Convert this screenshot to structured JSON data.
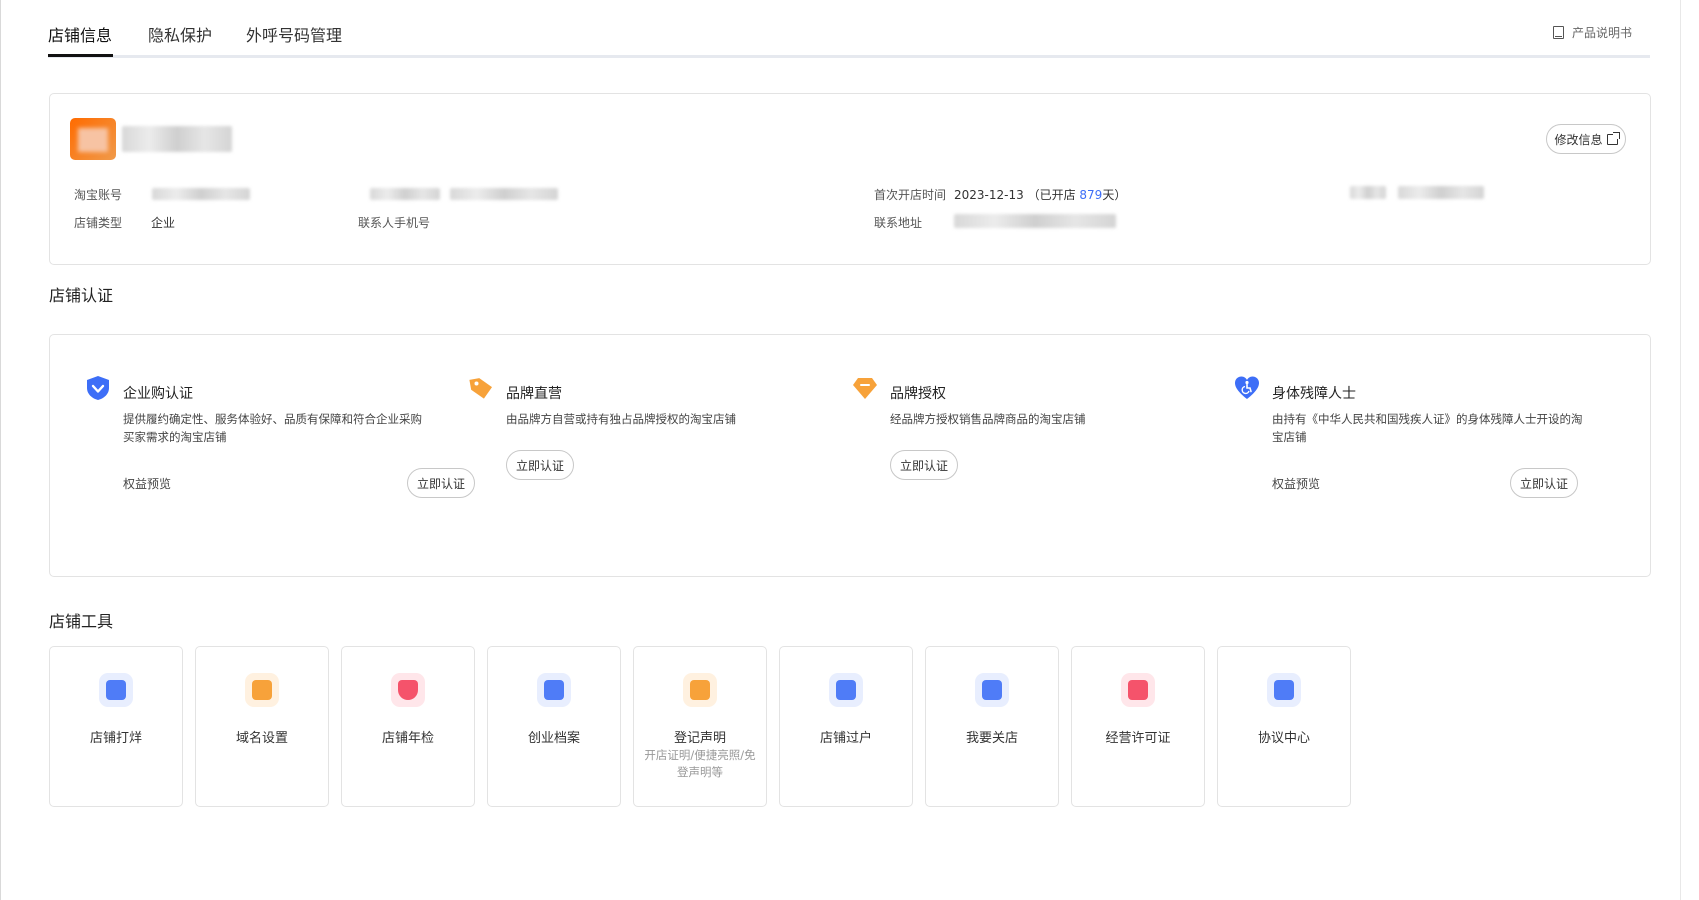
{
  "tabs": [
    {
      "label": "店铺信息",
      "active": true
    },
    {
      "label": "隐私保护",
      "active": false
    },
    {
      "label": "外呼号码管理",
      "active": false
    }
  ],
  "manual_label": "产品说明书",
  "store_info": {
    "edit_button": "修改信息",
    "fields": {
      "account_label": "淘宝账号",
      "type_label": "店铺类型",
      "type_value": "企业",
      "phone_label": "联系人手机号",
      "open_time_label": "首次开店时间",
      "open_time_value": "2023-12-13",
      "open_days_prefix": "（已开店 ",
      "open_days_value": "879",
      "open_days_suffix": "天）",
      "address_label": "联系地址"
    }
  },
  "certification": {
    "title": "店铺认证",
    "items": [
      {
        "title": "企业购认证",
        "desc": "提供履约确定性、服务体验好、品质有保障和符合企业采购买家需求的淘宝店铺",
        "link": "权益预览",
        "button": "立即认证",
        "icon": "shield-check-icon",
        "color": "#3d6ef7"
      },
      {
        "title": "品牌直营",
        "desc": "由品牌方自营或持有独占品牌授权的淘宝店铺",
        "link": "",
        "button": "立即认证",
        "icon": "tag-icon",
        "color": "#f7a23a"
      },
      {
        "title": "品牌授权",
        "desc": "经品牌方授权销售品牌商品的淘宝店铺",
        "link": "",
        "button": "立即认证",
        "icon": "diamond-icon",
        "color": "#f7a23a"
      },
      {
        "title": "身体残障人士",
        "desc": "由持有《中华人民共和国残疾人证》的身体残障人士开设的淘宝店铺",
        "link": "权益预览",
        "button": "立即认证",
        "icon": "heart-accessibility-icon",
        "color": "#3d6ef7"
      }
    ]
  },
  "tools": {
    "title": "店铺工具",
    "items": [
      {
        "label": "店铺打烊",
        "sub": "",
        "icon": "store-close-icon",
        "color": "#4f7cf7"
      },
      {
        "label": "域名设置",
        "sub": "",
        "icon": "domain-icon",
        "color": "#f7a23a"
      },
      {
        "label": "店铺年检",
        "sub": "",
        "icon": "annual-check-icon",
        "color": "#f5536b"
      },
      {
        "label": "创业档案",
        "sub": "",
        "icon": "archive-icon",
        "color": "#4f7cf7"
      },
      {
        "label": "登记声明",
        "sub": "开店证明/便捷亮照/免登声明等",
        "icon": "register-icon",
        "color": "#f7a23a"
      },
      {
        "label": "店铺过户",
        "sub": "",
        "icon": "transfer-icon",
        "color": "#4f7cf7"
      },
      {
        "label": "我要关店",
        "sub": "",
        "icon": "close-store-icon",
        "color": "#4f7cf7"
      },
      {
        "label": "经营许可证",
        "sub": "",
        "icon": "license-icon",
        "color": "#f5536b"
      },
      {
        "label": "协议中心",
        "sub": "",
        "icon": "agreement-icon",
        "color": "#4f7cf7"
      }
    ]
  }
}
